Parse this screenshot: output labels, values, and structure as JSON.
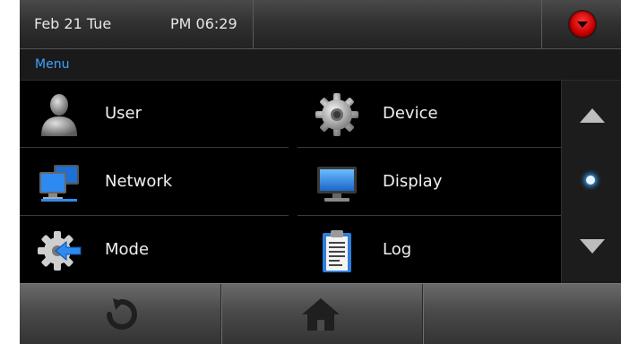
{
  "status": {
    "date": "Feb 21 Tue",
    "time": "PM 06:29",
    "dropdown_icon": "red-dropdown-icon"
  },
  "menu": {
    "title": "Menu"
  },
  "items": [
    {
      "label": "User",
      "icon": "user-icon"
    },
    {
      "label": "Device",
      "icon": "gear-icon"
    },
    {
      "label": "Network",
      "icon": "network-icon"
    },
    {
      "label": "Display",
      "icon": "monitor-icon"
    },
    {
      "label": "Mode",
      "icon": "mode-gear-arrow-icon"
    },
    {
      "label": "Log",
      "icon": "clipboard-icon"
    }
  ],
  "scroll": {
    "up_icon": "arrow-up-icon",
    "down_icon": "arrow-down-icon",
    "page": 1
  },
  "bottom": {
    "refresh_icon": "refresh-icon",
    "home_icon": "home-icon"
  },
  "colors": {
    "accent": "#3ea3ff",
    "background": "#000000",
    "alert": "#d40000"
  }
}
